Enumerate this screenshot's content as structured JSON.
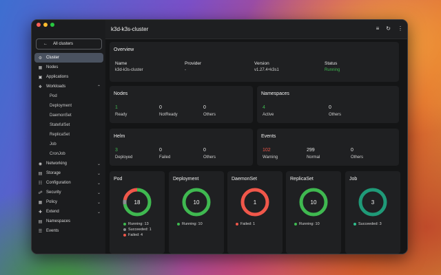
{
  "window": {
    "title": "k3d-k3s-cluster",
    "traffic_colors": [
      "#ff5f57",
      "#febc2e",
      "#28c840"
    ]
  },
  "sidebar": {
    "back_label": "All clusters",
    "items": [
      {
        "label": "Cluster",
        "icon": "gear-icon"
      },
      {
        "label": "Nodes",
        "icon": "nodes-icon"
      },
      {
        "label": "Applications",
        "icon": "grid-icon"
      },
      {
        "label": "Workloads",
        "icon": "workloads-icon"
      },
      {
        "label": "Pod"
      },
      {
        "label": "Deployment"
      },
      {
        "label": "DaemonSet"
      },
      {
        "label": "StatefulSet"
      },
      {
        "label": "ReplicaSet"
      },
      {
        "label": "Job"
      },
      {
        "label": "CronJob"
      },
      {
        "label": "Networking",
        "icon": "network-icon"
      },
      {
        "label": "Storage",
        "icon": "storage-icon"
      },
      {
        "label": "Configuration",
        "icon": "config-icon"
      },
      {
        "label": "Security",
        "icon": "security-icon"
      },
      {
        "label": "Policy",
        "icon": "policy-icon"
      },
      {
        "label": "Extend",
        "icon": "extend-icon"
      },
      {
        "label": "Namespaces",
        "icon": "namespaces-icon"
      },
      {
        "label": "Events",
        "icon": "events-icon"
      }
    ]
  },
  "overview": {
    "title": "Overview",
    "fields": [
      {
        "label": "Name",
        "value": "k3d-k3s-cluster"
      },
      {
        "label": "Provider",
        "value": "-"
      },
      {
        "label": "Version",
        "value": "v1.27.4+k3s1"
      },
      {
        "label": "Status",
        "value": "Running"
      }
    ]
  },
  "nodes": {
    "title": "Nodes",
    "stats": [
      {
        "value": "1",
        "label": "Ready"
      },
      {
        "value": "0",
        "label": "NotReady"
      },
      {
        "value": "0",
        "label": "Others"
      }
    ]
  },
  "namespaces": {
    "title": "Namespaces",
    "stats": [
      {
        "value": "4",
        "label": "Active"
      },
      {
        "value": "0",
        "label": "Others"
      }
    ]
  },
  "helm": {
    "title": "Helm",
    "stats": [
      {
        "value": "3",
        "label": "Deployed"
      },
      {
        "value": "0",
        "label": "Failed"
      },
      {
        "value": "0",
        "label": "Others"
      }
    ]
  },
  "events": {
    "title": "Events",
    "stats": [
      {
        "value": "102",
        "label": "Warning"
      },
      {
        "value": "299",
        "label": "Normal"
      },
      {
        "value": "0",
        "label": "Others"
      }
    ]
  },
  "workloads": [
    {
      "title": "Pod",
      "total": "18",
      "segments": [
        {
          "value": 13,
          "color": "#3fb950"
        },
        {
          "value": 1,
          "color": "#8b8d91"
        },
        {
          "value": 4,
          "color": "#f0574a"
        }
      ],
      "legend": [
        {
          "text": "Running: 13",
          "color": "#3fb950"
        },
        {
          "text": "Succeeded: 1",
          "color": "#8b8d91"
        },
        {
          "text": "Failed: 4",
          "color": "#f0574a"
        }
      ]
    },
    {
      "title": "Deployment",
      "total": "10",
      "segments": [
        {
          "value": 10,
          "color": "#3fb950"
        }
      ],
      "legend": [
        {
          "text": "Running: 10",
          "color": "#3fb950"
        }
      ]
    },
    {
      "title": "DaemonSet",
      "total": "1",
      "segments": [
        {
          "value": 1,
          "color": "#f0574a"
        }
      ],
      "legend": [
        {
          "text": "Failed: 1",
          "color": "#f0574a"
        }
      ]
    },
    {
      "title": "ReplicaSet",
      "total": "10",
      "segments": [
        {
          "value": 10,
          "color": "#3fb950"
        }
      ],
      "legend": [
        {
          "text": "Running: 10",
          "color": "#3fb950"
        }
      ]
    },
    {
      "title": "Job",
      "total": "3",
      "segments": [
        {
          "value": 3,
          "color": "#1f9a78"
        }
      ],
      "legend": [
        {
          "text": "Succeeded: 3",
          "color": "#2fbf8f"
        }
      ]
    }
  ],
  "colors": {
    "running": "#3fb950",
    "failed": "#f0574a",
    "succeeded": "#2fbf8f",
    "active_nav": "#4a5260"
  }
}
